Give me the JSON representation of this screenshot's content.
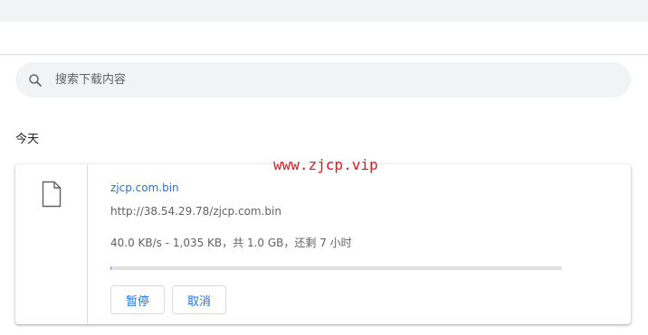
{
  "search": {
    "placeholder": "搜索下载内容",
    "icon": "search-icon"
  },
  "section": {
    "date_label": "今天"
  },
  "downloads": [
    {
      "icon": "file-icon",
      "file_name": "zjcp.com.bin",
      "url": "http://38.54.29.78/zjcp.com.bin",
      "status": "40.0 KB/s - 1,035 KB，共 1.0 GB，还剩 7 小时",
      "progress": 0.001,
      "pause_label": "暂停",
      "cancel_label": "取消"
    }
  ],
  "watermark": "www.zjcp.vip",
  "colors": {
    "accent": "#1a73e8",
    "watermark": "#e5161c",
    "search_bg": "#f1f3f4",
    "progress_track": "#e0e0e0"
  }
}
